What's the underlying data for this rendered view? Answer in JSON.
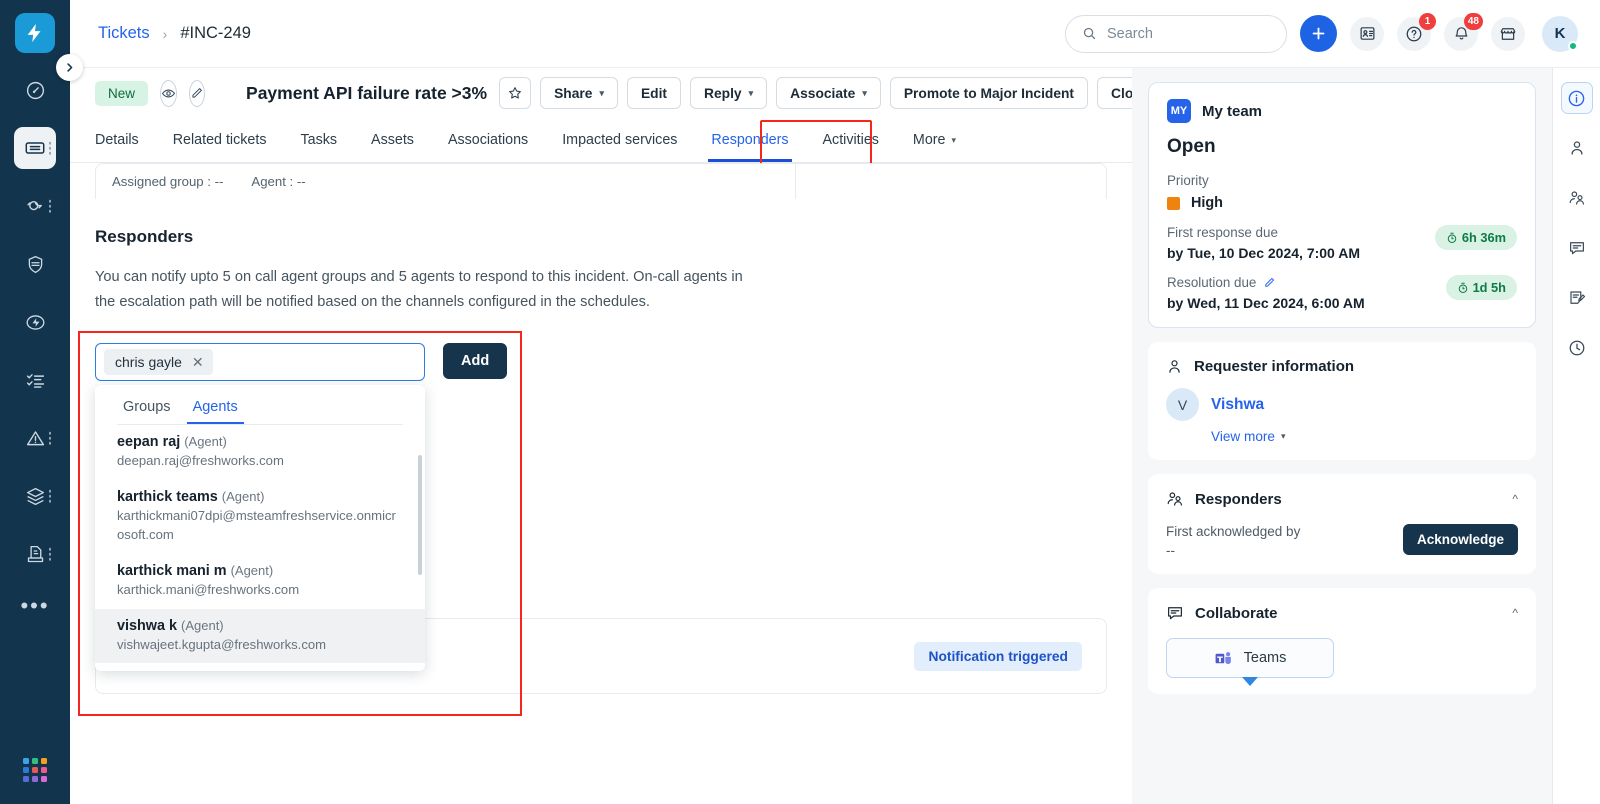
{
  "left_rail": {
    "logo_icon": "freshworks-bolt-logo",
    "items": [
      {
        "name": "dashboard-icon",
        "has_dots": false
      },
      {
        "name": "tickets-icon",
        "has_dots": true,
        "active": true
      },
      {
        "name": "problems-icon",
        "has_dots": true
      },
      {
        "name": "changes-icon",
        "has_dots": false
      },
      {
        "name": "releases-icon",
        "has_dots": false
      },
      {
        "name": "alerts-icon",
        "has_dots": false
      },
      {
        "name": "tasks-icon",
        "has_dots": false
      },
      {
        "name": "incidents-icon",
        "has_dots": true
      },
      {
        "name": "assets-icon",
        "has_dots": true
      },
      {
        "name": "contracts-icon",
        "has_dots": true
      }
    ],
    "more_label": "•••",
    "collapse_icon": "chevron-right-icon"
  },
  "topbar": {
    "breadcrumb": {
      "parent": "Tickets",
      "separator": "›",
      "current": "#INC-249"
    },
    "search": {
      "placeholder": "Search",
      "icon": "search-icon"
    },
    "add_button": {
      "icon": "plus-icon",
      "label": "+"
    },
    "contacts_icon": "contact-card-icon",
    "help": {
      "icon": "question-circle-icon",
      "badge": "1"
    },
    "notifications": {
      "icon": "bell-icon",
      "badge": "48"
    },
    "marketplace_icon": "marketplace-icon",
    "avatar": {
      "initial": "K",
      "status": "online"
    }
  },
  "ticket_header": {
    "status_pill": "New",
    "watch_icon": "eye-icon",
    "edit_icon": "pencil-icon",
    "title": "Payment API failure rate >3%",
    "actions": {
      "favorite_icon": "star-icon",
      "share": "Share",
      "edit": "Edit",
      "reply": "Reply",
      "associate": "Associate",
      "promote": "Promote to Major Incident",
      "close": "Close",
      "more_icon": "kebab-menu-icon",
      "prev_icon": "chevron-left-icon",
      "next_icon": "chevron-right-icon"
    }
  },
  "tabs": {
    "items": [
      {
        "label": "Details",
        "active": false
      },
      {
        "label": "Related tickets",
        "active": false
      },
      {
        "label": "Tasks",
        "active": false
      },
      {
        "label": "Assets",
        "active": false
      },
      {
        "label": "Associations",
        "active": false
      },
      {
        "label": "Impacted services",
        "active": false
      },
      {
        "label": "Responders",
        "active": true
      },
      {
        "label": "Activities",
        "active": false
      },
      {
        "label": "More",
        "active": false
      }
    ]
  },
  "assigned_bar": {
    "group_label": "Assigned group : --",
    "agent_label": "Agent : --"
  },
  "responders_section": {
    "title": "Responders",
    "description": "You can notify upto 5 on call agent groups and 5 agents to respond to this incident. On-call agents in the escalation path will be notified based on the channels configured in the schedules.",
    "selected_chip": {
      "label": "chris gayle",
      "remove_icon": "close-icon"
    },
    "add_button": "Add",
    "dropdown": {
      "tabs": [
        {
          "label": "Groups",
          "active": false
        },
        {
          "label": "Agents",
          "active": true
        }
      ],
      "agents": [
        {
          "name": "eepan raj",
          "role": "(Agent)",
          "email": "deepan.raj@freshworks.com",
          "selected": false
        },
        {
          "name": "karthick teams",
          "role": "(Agent)",
          "email": "karthickmani07dpi@msteamfreshservice.onmicrosoft.com",
          "selected": false
        },
        {
          "name": "karthick mani m",
          "role": "(Agent)",
          "email": "karthick.mani@freshworks.com",
          "selected": false
        },
        {
          "name": "vishwa k",
          "role": "(Agent)",
          "email": "vishwajeet.kgupta@freshworks.com",
          "selected": true
        }
      ]
    },
    "notification_badge": "Notification triggered"
  },
  "right_panel": {
    "summary": {
      "team_badge": "MY",
      "team_name": "My team",
      "status": "Open",
      "priority_label": "Priority",
      "priority_value": "High",
      "priority_color": "#f08310",
      "first_response_label": "First response due",
      "first_response_value": "by Tue, 10 Dec 2024, 7:00 AM",
      "first_response_timer": "6h 36m",
      "resolution_label": "Resolution due",
      "resolution_edit_icon": "pencil-icon",
      "resolution_value": "by Wed, 11 Dec 2024, 6:00 AM",
      "resolution_timer": "1d 5h"
    },
    "requester": {
      "icon": "person-icon",
      "title": "Requester information",
      "avatar_initial": "V",
      "name": "Vishwa",
      "view_more": "View more",
      "chevron_icon": "chevron-down-icon"
    },
    "responders_card": {
      "icon": "people-icon",
      "title": "Responders",
      "collapse_icon": "chevron-up-icon",
      "first_ack_label": "First acknowledged by",
      "first_ack_value": "--",
      "acknowledge_button": "Acknowledge"
    },
    "collaborate": {
      "icon": "chat-icon",
      "title": "Collaborate",
      "collapse_icon": "chevron-up-icon",
      "teams_label": "Teams",
      "teams_icon": "microsoft-teams-icon"
    }
  },
  "far_rail": {
    "items": [
      {
        "name": "info-icon",
        "active": true
      },
      {
        "name": "requester-icon",
        "active": false
      },
      {
        "name": "responders-icon",
        "active": false
      },
      {
        "name": "collaborate-icon",
        "active": false
      },
      {
        "name": "notes-icon",
        "active": false
      },
      {
        "name": "history-icon",
        "active": false
      }
    ]
  }
}
